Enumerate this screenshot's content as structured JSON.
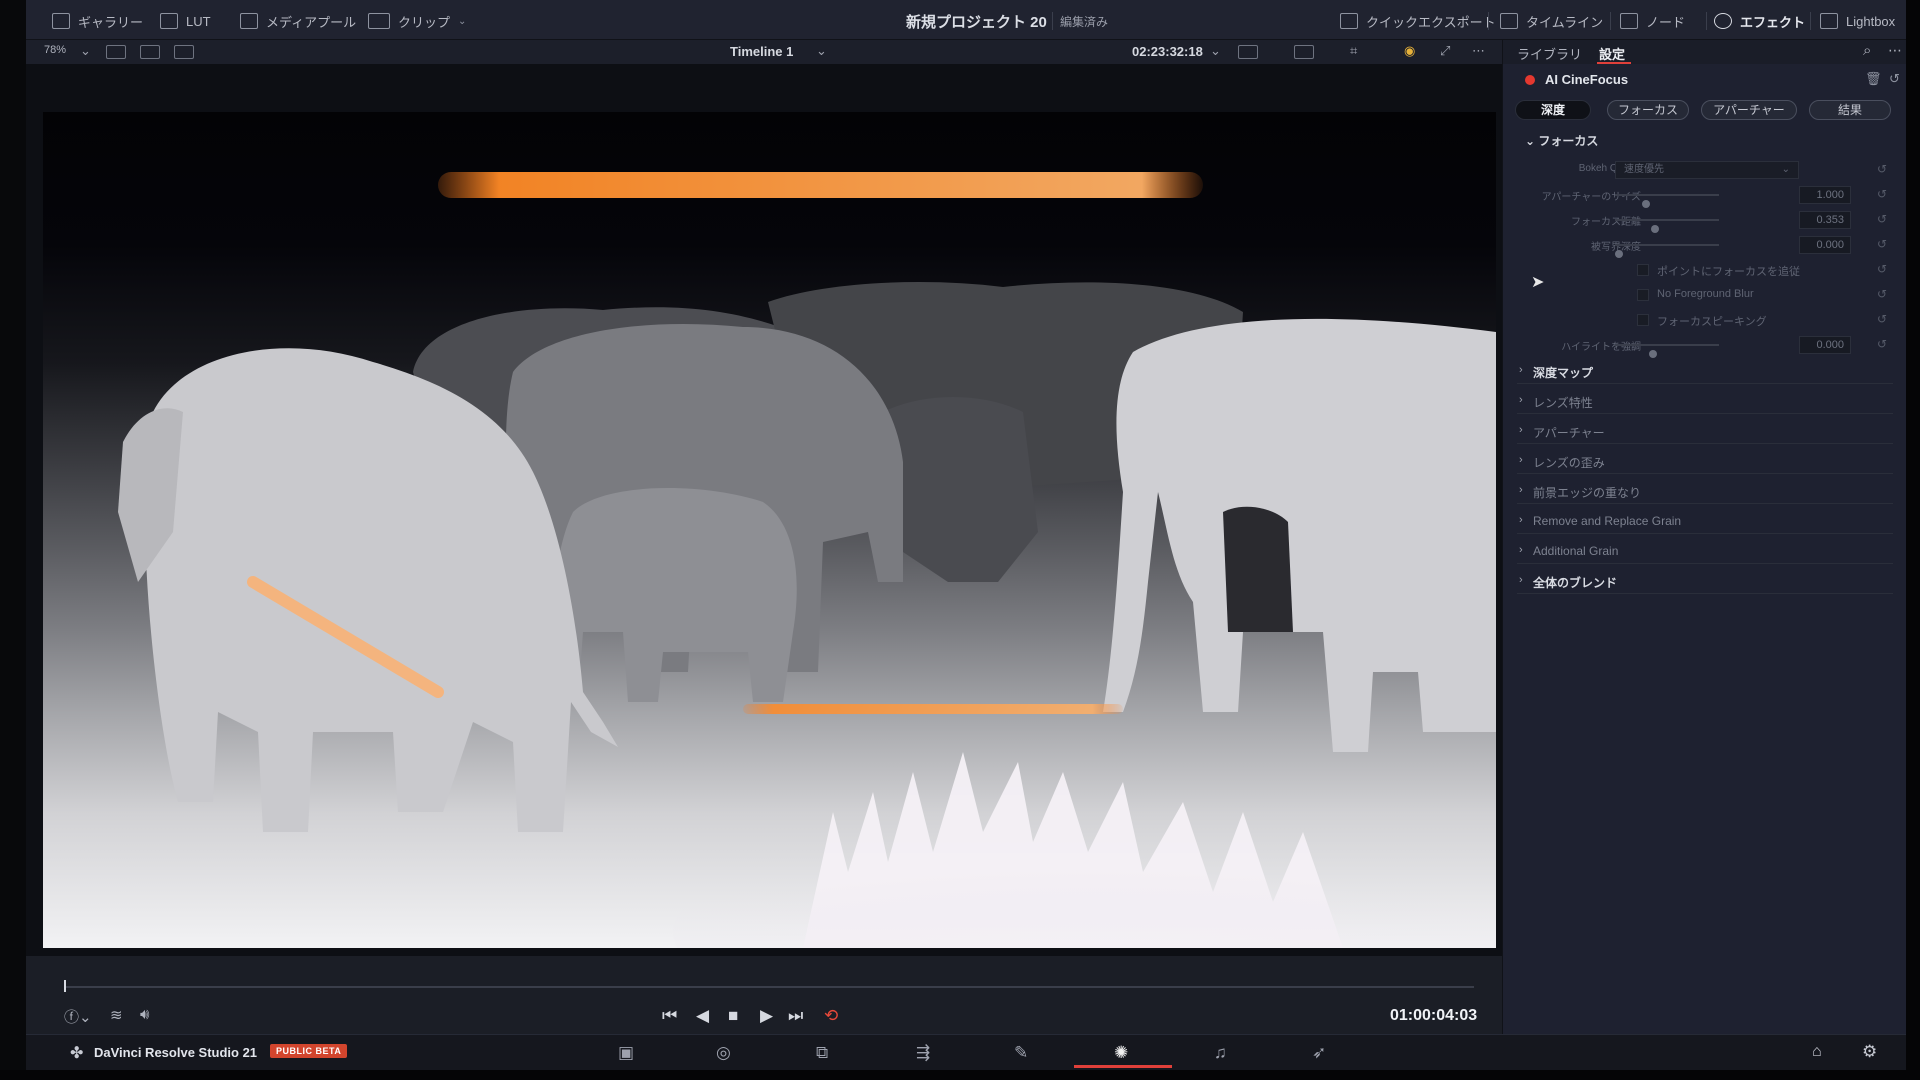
{
  "topbar": {
    "gallery": "ギャラリー",
    "lut": "LUT",
    "media_pool": "メディアプール",
    "clips": "クリップ",
    "project_title": "新規プロジェクト 20",
    "project_status": "編集済み",
    "quick_export": "クイックエクスポート",
    "timeline": "タイムライン",
    "nodes": "ノード",
    "effects": "エフェクト",
    "lightbox": "Lightbox"
  },
  "viewer": {
    "zoom": "78%",
    "timeline_name": "Timeline 1",
    "timecode": "02:23:32:18"
  },
  "transport": {
    "timecode": "01:00:04:03"
  },
  "pagebar": {
    "app_name": "DaVinci Resolve Studio 21",
    "badge": "PUBLIC BETA",
    "active_page": "color"
  },
  "inspector": {
    "tabs": [
      "ライブラリ",
      "設定"
    ],
    "active_tab": "設定",
    "effect_name": "AI CineFocus",
    "segments": [
      "深度",
      "フォーカス",
      "アパーチャー",
      "結果"
    ],
    "active_segment": "深度",
    "open_section": "フォーカス",
    "bokeh_quality": {
      "label": "Bokeh Quality",
      "value": "速度優先"
    },
    "params": [
      {
        "label": "アパーチャーのサイズ",
        "value": "1.000",
        "position": 0.28
      },
      {
        "label": "フォーカス距離",
        "value": "0.353",
        "position": 0.38
      },
      {
        "label": "被写界深度",
        "value": "0.000",
        "position": 0.0
      }
    ],
    "checkboxes": [
      {
        "label": "ポイントにフォーカスを追従",
        "checked": false
      },
      {
        "label": "No Foreground Blur",
        "checked": false
      },
      {
        "label": "フォーカスピーキング",
        "checked": false
      }
    ],
    "highlight": {
      "label": "ハイライトを強調",
      "value": "0.000",
      "position": 0.35
    },
    "sections": [
      {
        "title": "深度マップ",
        "bright": true
      },
      {
        "title": "レンズ特性",
        "bright": false
      },
      {
        "title": "アパーチャー",
        "bright": false
      },
      {
        "title": "レンズの歪み",
        "bright": false
      },
      {
        "title": "前景エッジの重なり",
        "bright": false
      },
      {
        "title": "Remove and Replace Grain",
        "bright": false
      },
      {
        "title": "Additional Grain",
        "bright": false
      },
      {
        "title": "全体のブレンド",
        "bright": true
      }
    ]
  },
  "colors": {
    "accent_red": "#e0403a",
    "beta_badge": "#d2452d",
    "panel_bg": "#1e2130"
  },
  "icons": [
    "gallery-icon",
    "lut-icon",
    "media-pool-icon",
    "clips-icon",
    "quick-export-icon",
    "timeline-icon",
    "nodes-icon",
    "effects-icon",
    "lightbox-icon",
    "search-icon",
    "more-icon",
    "trash-icon",
    "reset-icon",
    "home-icon",
    "gear-icon"
  ]
}
